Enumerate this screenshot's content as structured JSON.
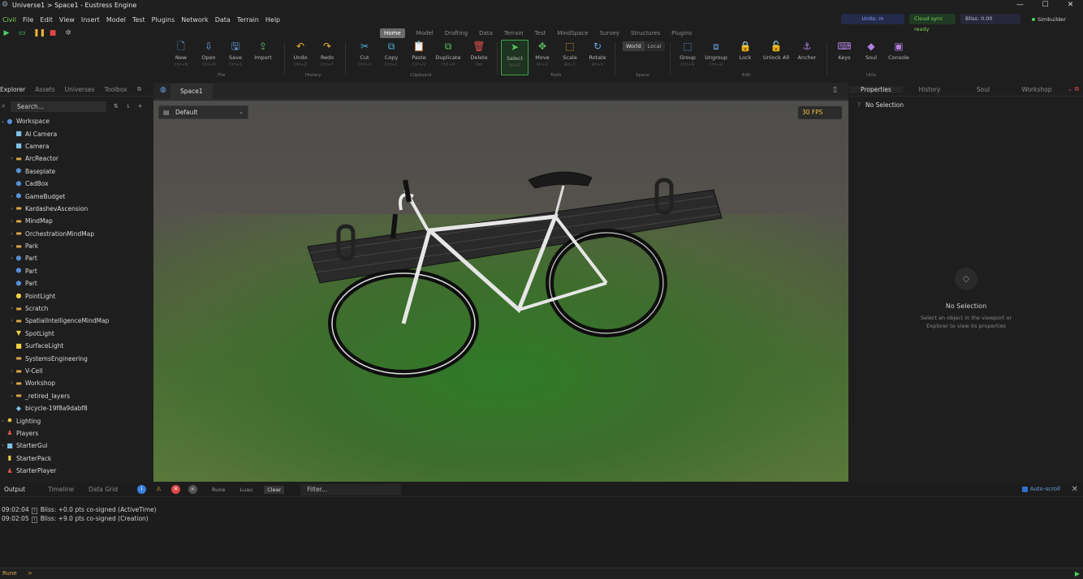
{
  "window": {
    "title": "Universe1 > Space1 - Eustress Engine",
    "controls": [
      "—",
      "☐",
      "✕"
    ]
  },
  "menu": [
    "Civil",
    "File",
    "Edit",
    "View",
    "Insert",
    "Model",
    "Test",
    "Plugins",
    "Network",
    "Data",
    "Terrain",
    "Help"
  ],
  "status": {
    "units": "Units: m",
    "cloud": "Cloud sync ready",
    "bliss": "Bliss: 0.00",
    "user": "Simbuilder"
  },
  "ribbon_tabs": [
    "Home",
    "Model",
    "Drafting",
    "Data",
    "Terrain",
    "Test",
    "MindSpace",
    "Survey",
    "Structures",
    "Plugins"
  ],
  "ribbon": {
    "buttons": [
      {
        "id": "new",
        "label": "New",
        "shortcut": "Ctrl+N",
        "icon": "new-file-icon",
        "glyph": "🗋",
        "color": "#6aa6e8"
      },
      {
        "id": "open",
        "label": "Open",
        "shortcut": "Ctrl+O",
        "icon": "open-folder-icon",
        "glyph": "⇩",
        "color": "#6aa6e8"
      },
      {
        "id": "save",
        "label": "Save",
        "shortcut": "Ctrl+S",
        "icon": "save-icon",
        "glyph": "🖫",
        "color": "#6aa6e8"
      },
      {
        "id": "import",
        "label": "Import",
        "shortcut": "",
        "icon": "import-icon",
        "glyph": "⇪",
        "color": "#58c060"
      },
      {
        "id": "undo",
        "label": "Undo",
        "shortcut": "Ctrl+Z",
        "icon": "undo-icon",
        "glyph": "↶",
        "color": "#f0b43a"
      },
      {
        "id": "redo",
        "label": "Redo",
        "shortcut": "Ctrl+Y",
        "icon": "redo-icon",
        "glyph": "↷",
        "color": "#f0b43a"
      },
      {
        "id": "cut",
        "label": "Cut",
        "shortcut": "Ctrl+X",
        "icon": "cut-icon",
        "glyph": "✂",
        "color": "#4ab0d8"
      },
      {
        "id": "copy",
        "label": "Copy",
        "shortcut": "Ctrl+C",
        "icon": "copy-icon",
        "glyph": "⧉",
        "color": "#4ab0d8"
      },
      {
        "id": "paste",
        "label": "Paste",
        "shortcut": "Ctrl+V",
        "icon": "paste-icon",
        "glyph": "📋",
        "color": "#4ab0d8"
      },
      {
        "id": "duplicate",
        "label": "Duplicate",
        "shortcut": "Ctrl+D",
        "icon": "duplicate-icon",
        "glyph": "⧉",
        "color": "#58c060"
      },
      {
        "id": "delete",
        "label": "Delete",
        "shortcut": "Del",
        "icon": "trash-icon",
        "glyph": "🗑",
        "color": "#e05050"
      },
      {
        "id": "select",
        "label": "Select",
        "shortcut": "Alt+Z",
        "icon": "cursor-icon",
        "glyph": "➤",
        "color": "#58c060"
      },
      {
        "id": "move",
        "label": "Move",
        "shortcut": "Alt+X",
        "icon": "move-icon",
        "glyph": "✥",
        "color": "#58c060"
      },
      {
        "id": "scale",
        "label": "Scale",
        "shortcut": "Alt+C",
        "icon": "scale-icon",
        "glyph": "⬚",
        "color": "#f0b43a"
      },
      {
        "id": "rotate",
        "label": "Rotate",
        "shortcut": "Alt+V",
        "icon": "rotate-icon",
        "glyph": "↻",
        "color": "#6aa6e8"
      },
      {
        "id": "group",
        "label": "Group",
        "shortcut": "Ctrl+G",
        "icon": "group-icon",
        "glyph": "⬚",
        "color": "#6aa6e8"
      },
      {
        "id": "ungroup",
        "label": "Ungroup",
        "shortcut": "Ctrl+U",
        "icon": "ungroup-icon",
        "glyph": "⧈",
        "color": "#6aa6e8"
      },
      {
        "id": "lock",
        "label": "Lock",
        "shortcut": "",
        "icon": "lock-icon",
        "glyph": "🔒",
        "color": "#f0b43a"
      },
      {
        "id": "unlockall",
        "label": "Unlock All",
        "shortcut": "",
        "icon": "unlock-icon",
        "glyph": "🔓",
        "color": "#f0b43a"
      },
      {
        "id": "anchor",
        "label": "Anchor",
        "shortcut": "",
        "icon": "anchor-icon",
        "glyph": "⚓",
        "color": "#b080e0"
      },
      {
        "id": "keys",
        "label": "Keys",
        "shortcut": "",
        "icon": "keyboard-icon",
        "glyph": "⌨",
        "color": "#b080e0"
      },
      {
        "id": "soul",
        "label": "Soul",
        "shortcut": "",
        "icon": "soul-diamond-icon",
        "glyph": "◆",
        "color": "#b080e0"
      },
      {
        "id": "console",
        "label": "Console",
        "shortcut": "",
        "icon": "console-icon",
        "glyph": "▣",
        "color": "#b080e0"
      }
    ],
    "groups": {
      "file": "File",
      "history": "History",
      "clipboard": "Clipboard",
      "tools": "Tools",
      "space": "Space",
      "edit": "Edit",
      "utils": "Utils"
    },
    "space_toggle": [
      "World",
      "Local"
    ]
  },
  "explorer": {
    "tabs": [
      "Explorer",
      "Assets",
      "Universes",
      "Toolbox"
    ],
    "search_placeholder": "Search...",
    "tree": [
      {
        "label": "Workspace",
        "icon": "globe-icon",
        "glyph": "●",
        "kind": "cube",
        "indent": 0,
        "expander": "⌄"
      },
      {
        "label": "AI Camera",
        "icon": "camera-icon",
        "glyph": "■",
        "kind": "cam",
        "indent": 1,
        "expander": ""
      },
      {
        "label": "Camera",
        "icon": "camera-icon",
        "glyph": "■",
        "kind": "cam",
        "indent": 1,
        "expander": ""
      },
      {
        "label": "ArcReactor",
        "icon": "folder-icon",
        "glyph": "▬",
        "kind": "fold",
        "indent": 1,
        "expander": "›"
      },
      {
        "label": "Baseplate",
        "icon": "cube-icon",
        "glyph": "⬢",
        "kind": "cube",
        "indent": 1,
        "expander": ""
      },
      {
        "label": "CadBox",
        "icon": "cube-icon",
        "glyph": "⬢",
        "kind": "cube",
        "indent": 1,
        "expander": ""
      },
      {
        "label": "GameBudget",
        "icon": "cube-icon",
        "glyph": "⬢",
        "kind": "cube",
        "indent": 1,
        "expander": "›"
      },
      {
        "label": "KardashevAscension",
        "icon": "folder-icon",
        "glyph": "▬",
        "kind": "fold",
        "indent": 1,
        "expander": "›"
      },
      {
        "label": "MindMap",
        "icon": "folder-icon",
        "glyph": "▬",
        "kind": "fold",
        "indent": 1,
        "expander": "›"
      },
      {
        "label": "OrchestrationMindMap",
        "icon": "folder-icon",
        "glyph": "▬",
        "kind": "fold",
        "indent": 1,
        "expander": "›"
      },
      {
        "label": "Park",
        "icon": "folder-icon",
        "glyph": "▬",
        "kind": "fold",
        "indent": 1,
        "expander": "›"
      },
      {
        "label": "Part",
        "icon": "cube-icon",
        "glyph": "⬢",
        "kind": "cube",
        "indent": 1,
        "expander": "›"
      },
      {
        "label": "Part",
        "icon": "cube-icon",
        "glyph": "⬢",
        "kind": "cube",
        "indent": 1,
        "expander": ""
      },
      {
        "label": "Part",
        "icon": "cube-icon",
        "glyph": "⬢",
        "kind": "cube",
        "indent": 1,
        "expander": ""
      },
      {
        "label": "PointLight",
        "icon": "bulb-icon",
        "glyph": "●",
        "kind": "light",
        "indent": 1,
        "expander": ""
      },
      {
        "label": "Scratch",
        "icon": "folder-icon",
        "glyph": "▬",
        "kind": "fold",
        "indent": 1,
        "expander": "›"
      },
      {
        "label": "SpatialIntelligenceMindMap",
        "icon": "folder-icon",
        "glyph": "▬",
        "kind": "fold",
        "indent": 1,
        "expander": "›"
      },
      {
        "label": "SpotLight",
        "icon": "spotlight-icon",
        "glyph": "▼",
        "kind": "light",
        "indent": 1,
        "expander": ""
      },
      {
        "label": "SurfaceLight",
        "icon": "surface-light-icon",
        "glyph": "■",
        "kind": "light",
        "indent": 1,
        "expander": ""
      },
      {
        "label": "SystemsEngineering",
        "icon": "folder-icon",
        "glyph": "▬",
        "kind": "fold",
        "indent": 1,
        "expander": ""
      },
      {
        "label": "V-Cell",
        "icon": "folder-icon",
        "glyph": "▬",
        "kind": "fold",
        "indent": 1,
        "expander": "›"
      },
      {
        "label": "Workshop",
        "icon": "folder-icon",
        "glyph": "▬",
        "kind": "fold",
        "indent": 1,
        "expander": "›"
      },
      {
        "label": "_retired_layers",
        "icon": "folder-icon",
        "glyph": "▬",
        "kind": "fold",
        "indent": 1,
        "expander": "›"
      },
      {
        "label": "bicycle-19f8a9dabf8",
        "icon": "mesh-icon",
        "glyph": "◆",
        "kind": "cam",
        "indent": 1,
        "expander": ""
      },
      {
        "label": "Lighting",
        "icon": "sun-icon",
        "glyph": "✹",
        "kind": "light",
        "indent": 0,
        "expander": "›"
      },
      {
        "label": "Players",
        "icon": "players-icon",
        "glyph": "♟",
        "kind": "red",
        "indent": 0,
        "expander": ""
      },
      {
        "label": "StarterGui",
        "icon": "gui-icon",
        "glyph": "■",
        "kind": "cam",
        "indent": 0,
        "expander": "›"
      },
      {
        "label": "StarterPack",
        "icon": "backpack-icon",
        "glyph": "▮",
        "kind": "light",
        "indent": 0,
        "expander": ""
      },
      {
        "label": "StarterPlayer",
        "icon": "player-icon",
        "glyph": "♟",
        "kind": "red",
        "indent": 0,
        "expander": ""
      }
    ]
  },
  "viewport": {
    "tab": "Space1",
    "layout": "Default",
    "fps": "30 FPS"
  },
  "properties": {
    "tabs": [
      "Properties",
      "History",
      "Soul",
      "Workshop"
    ],
    "header": "No Selection",
    "empty_title": "No Selection",
    "empty_desc": "Select an object in the viewport or Explorer to view its properties"
  },
  "output": {
    "tabs": [
      "Output",
      "Timeline",
      "Data Grid"
    ],
    "chips": [
      "Rune",
      "Luau",
      "Clear"
    ],
    "filter_placeholder": "Filter...",
    "autoscroll": "Auto-scroll",
    "logs": [
      {
        "time": "09:02:04",
        "text": "Bliss: +0.0 pts co-signed (ActiveTime)"
      },
      {
        "time": "09:02:05",
        "text": "Bliss: +9.0 pts co-signed (Creation)"
      }
    ]
  },
  "cmd": {
    "label": "Rune",
    "prompt": ">"
  }
}
